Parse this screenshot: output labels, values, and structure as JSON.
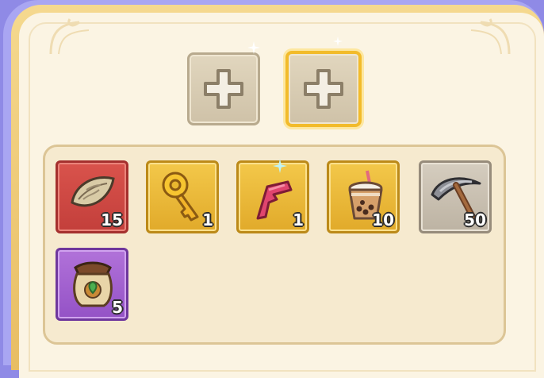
{
  "equip_slots": [
    {
      "icon": "plus-icon",
      "selected": false
    },
    {
      "icon": "plus-icon",
      "selected": true
    }
  ],
  "inventory": {
    "items": [
      {
        "icon": "gold-leaf-emblem-icon",
        "rarity_color": "red",
        "count": "15"
      },
      {
        "icon": "gold-key-icon",
        "rarity_color": "gold",
        "count": "1"
      },
      {
        "icon": "pink-key-icon",
        "rarity_color": "gold",
        "count": "1"
      },
      {
        "icon": "bubble-tea-icon",
        "rarity_color": "gold",
        "count": "10"
      },
      {
        "icon": "pickaxe-icon",
        "rarity_color": "grey",
        "count": "50"
      },
      {
        "icon": "seed-bag-icon",
        "rarity_color": "purple",
        "count": "5"
      }
    ]
  },
  "colors": {
    "frame_purple": "#8f8ae6",
    "frame_gold": "#e8bd63",
    "panel_cream": "#fbf4e3",
    "selected_border": "#f2bb2b"
  }
}
